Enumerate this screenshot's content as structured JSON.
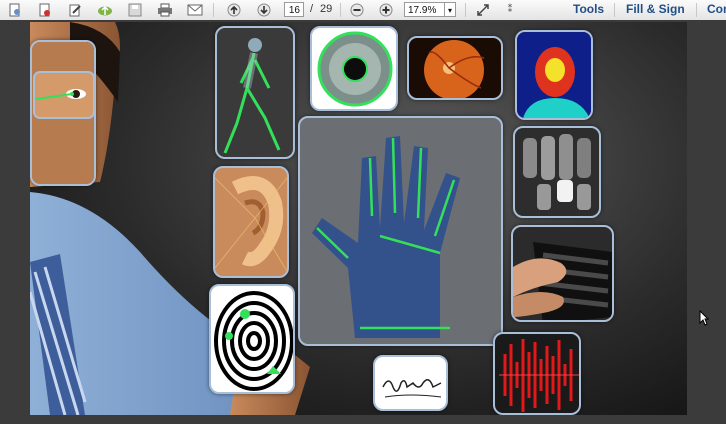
{
  "toolbar": {
    "page_current": "16",
    "page_separator": "/",
    "page_total": "29",
    "zoom_value": "17.9%",
    "tools_label": "Tools",
    "fill_sign_label": "Fill & Sign",
    "comment_label": "Con"
  },
  "icons": {
    "create": "create-icon",
    "create_pdf": "create-pdf-icon",
    "edit": "edit-icon",
    "upload": "cloud-upload-icon",
    "save": "save-icon",
    "print": "print-icon",
    "email": "email-icon",
    "prev_page": "arrow-up-icon",
    "next_page": "arrow-down-icon",
    "zoom_out": "minus-icon",
    "zoom_in": "plus-icon",
    "fit": "fit-page-icon",
    "more": "more-tools-icon"
  },
  "colors": {
    "accent_green": "#33e05a",
    "tile_border": "#a9bfd9",
    "menu_text": "#1f4f86"
  }
}
